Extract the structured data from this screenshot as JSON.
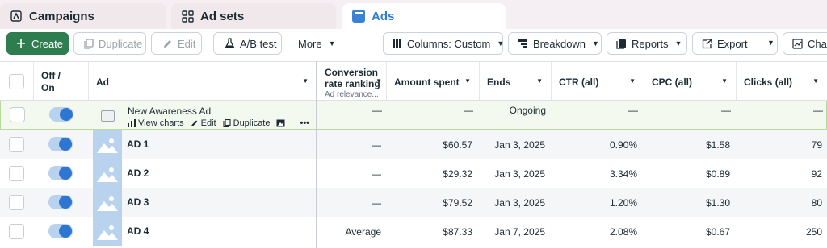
{
  "tabs": {
    "campaigns": "Campaigns",
    "adsets": "Ad sets",
    "ads": "Ads"
  },
  "toolbar": {
    "create": "Create",
    "duplicate": "Duplicate",
    "edit": "Edit",
    "ab_test": "A/B test",
    "more": "More",
    "columns": "Columns: Custom",
    "breakdown": "Breakdown",
    "reports": "Reports",
    "export": "Export",
    "chart": "Chart"
  },
  "columns": {
    "off_on_1": "Off /",
    "off_on_2": "On",
    "ad": "Ad",
    "conv_rank_1": "Conversion",
    "conv_rank_2": "rate ranking",
    "conv_rank_sub": "Ad relevance...",
    "amount": "Amount spent",
    "ends": "Ends",
    "ctr": "CTR (all)",
    "cpc": "CPC (all)",
    "clicks": "Clicks (all)"
  },
  "row_actions": {
    "view_charts": "View charts",
    "edit": "Edit",
    "duplicate": "Duplicate",
    "more": "•••"
  },
  "rows": [
    {
      "name": "New Awareness Ad",
      "on": true,
      "rank": "—",
      "amount": "—",
      "ends": "Ongoing",
      "ctr": "—",
      "cpc": "—",
      "clicks": "—"
    },
    {
      "name": "AD 1",
      "on": true,
      "rank": "—",
      "amount": "$60.57",
      "ends": "Jan 3, 2025",
      "ctr": "0.90%",
      "cpc": "$1.58",
      "clicks": "79"
    },
    {
      "name": "AD 2",
      "on": true,
      "rank": "—",
      "amount": "$29.32",
      "ends": "Jan 3, 2025",
      "ctr": "3.34%",
      "cpc": "$0.89",
      "clicks": "92"
    },
    {
      "name": "AD 3",
      "on": true,
      "rank": "—",
      "amount": "$79.52",
      "ends": "Jan 3, 2025",
      "ctr": "1.20%",
      "cpc": "$1.30",
      "clicks": "80"
    },
    {
      "name": "AD 4",
      "on": true,
      "rank": "Average",
      "amount": "$87.33",
      "ends": "Jan 7, 2025",
      "ctr": "2.08%",
      "cpc": "$0.67",
      "clicks": "250"
    }
  ],
  "colors": {
    "create_green": "#2e7d4f",
    "active_tab_blue": "#2d7dd2",
    "toggle_on": "#2f76d0",
    "selected_row_bg": "#f3f9ee"
  }
}
